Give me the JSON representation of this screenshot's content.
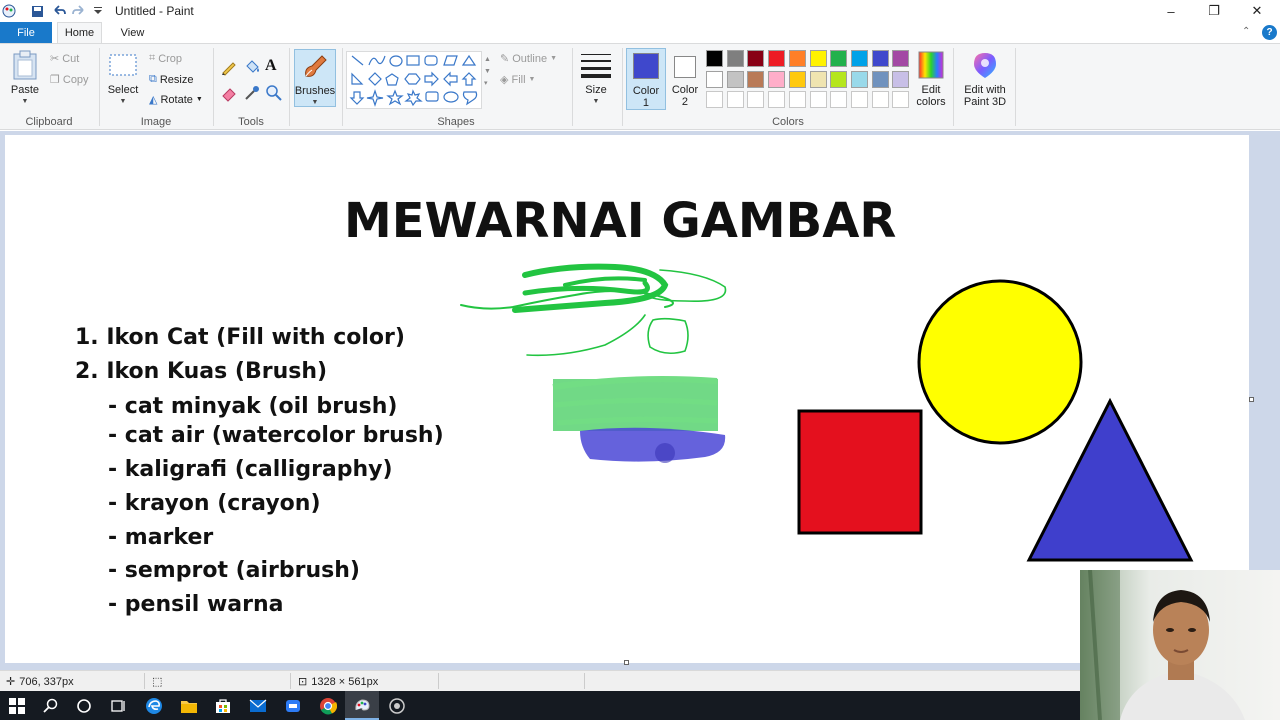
{
  "window": {
    "title": "Untitled - Paint",
    "minimize": "–",
    "restore": "❐",
    "close": "✕"
  },
  "tabs": {
    "file": "File",
    "home": "Home",
    "view": "View"
  },
  "ribbon": {
    "clipboard": {
      "label": "Clipboard",
      "paste": "Paste",
      "cut": "Cut",
      "copy": "Copy"
    },
    "image": {
      "label": "Image",
      "select": "Select",
      "crop": "Crop",
      "resize": "Resize",
      "rotate": "Rotate"
    },
    "tools": {
      "label": "Tools"
    },
    "brushes": {
      "label": "Brushes"
    },
    "shapes": {
      "label": "Shapes",
      "outline": "Outline",
      "fill": "Fill"
    },
    "size": {
      "label": "Size"
    },
    "color1": {
      "label": "Color\n1",
      "value": "#3f48cc"
    },
    "color2": {
      "label": "Color\n2",
      "value": "#ffffff"
    },
    "colors": {
      "label": "Colors",
      "row1": [
        "#000000",
        "#7f7f7f",
        "#880015",
        "#ed1c24",
        "#ff7f27",
        "#fff200",
        "#22b14c",
        "#00a2e8",
        "#3f48cc",
        "#a349a4"
      ],
      "row2": [
        "#ffffff",
        "#c3c3c3",
        "#b97a57",
        "#ffaec9",
        "#ffc90e",
        "#efe4b0",
        "#b5e61d",
        "#99d9ea",
        "#7092be",
        "#c8bfe7"
      ],
      "row3": [
        "#ffffff",
        "#ffffff",
        "#ffffff",
        "#ffffff",
        "#ffffff",
        "#ffffff",
        "#ffffff",
        "#ffffff",
        "#ffffff",
        "#ffffff"
      ]
    },
    "edit_colors": "Edit\ncolors",
    "edit_paint3d": "Edit with\nPaint 3D"
  },
  "canvas": {
    "heading": "MEWARNAI GAMBAR",
    "lines": [
      "1. Ikon Cat (Fill with color)",
      "2. Ikon Kuas (Brush)",
      "- cat minyak (oil brush)",
      "- cat air (watercolor brush)",
      "- kaligrafi (calligraphy)",
      "- krayon (crayon)",
      "- marker",
      "- semprot (airbrush)",
      "- pensil warna"
    ],
    "shape_colors": {
      "circle": "#ffff00",
      "square": "#e4101e",
      "triangle": "#3f3fcc",
      "green": "#22c441",
      "blue": "#4a46d6"
    }
  },
  "status": {
    "cursor_pos": "706, 337px",
    "canvas_size": "1328 × 561px"
  }
}
